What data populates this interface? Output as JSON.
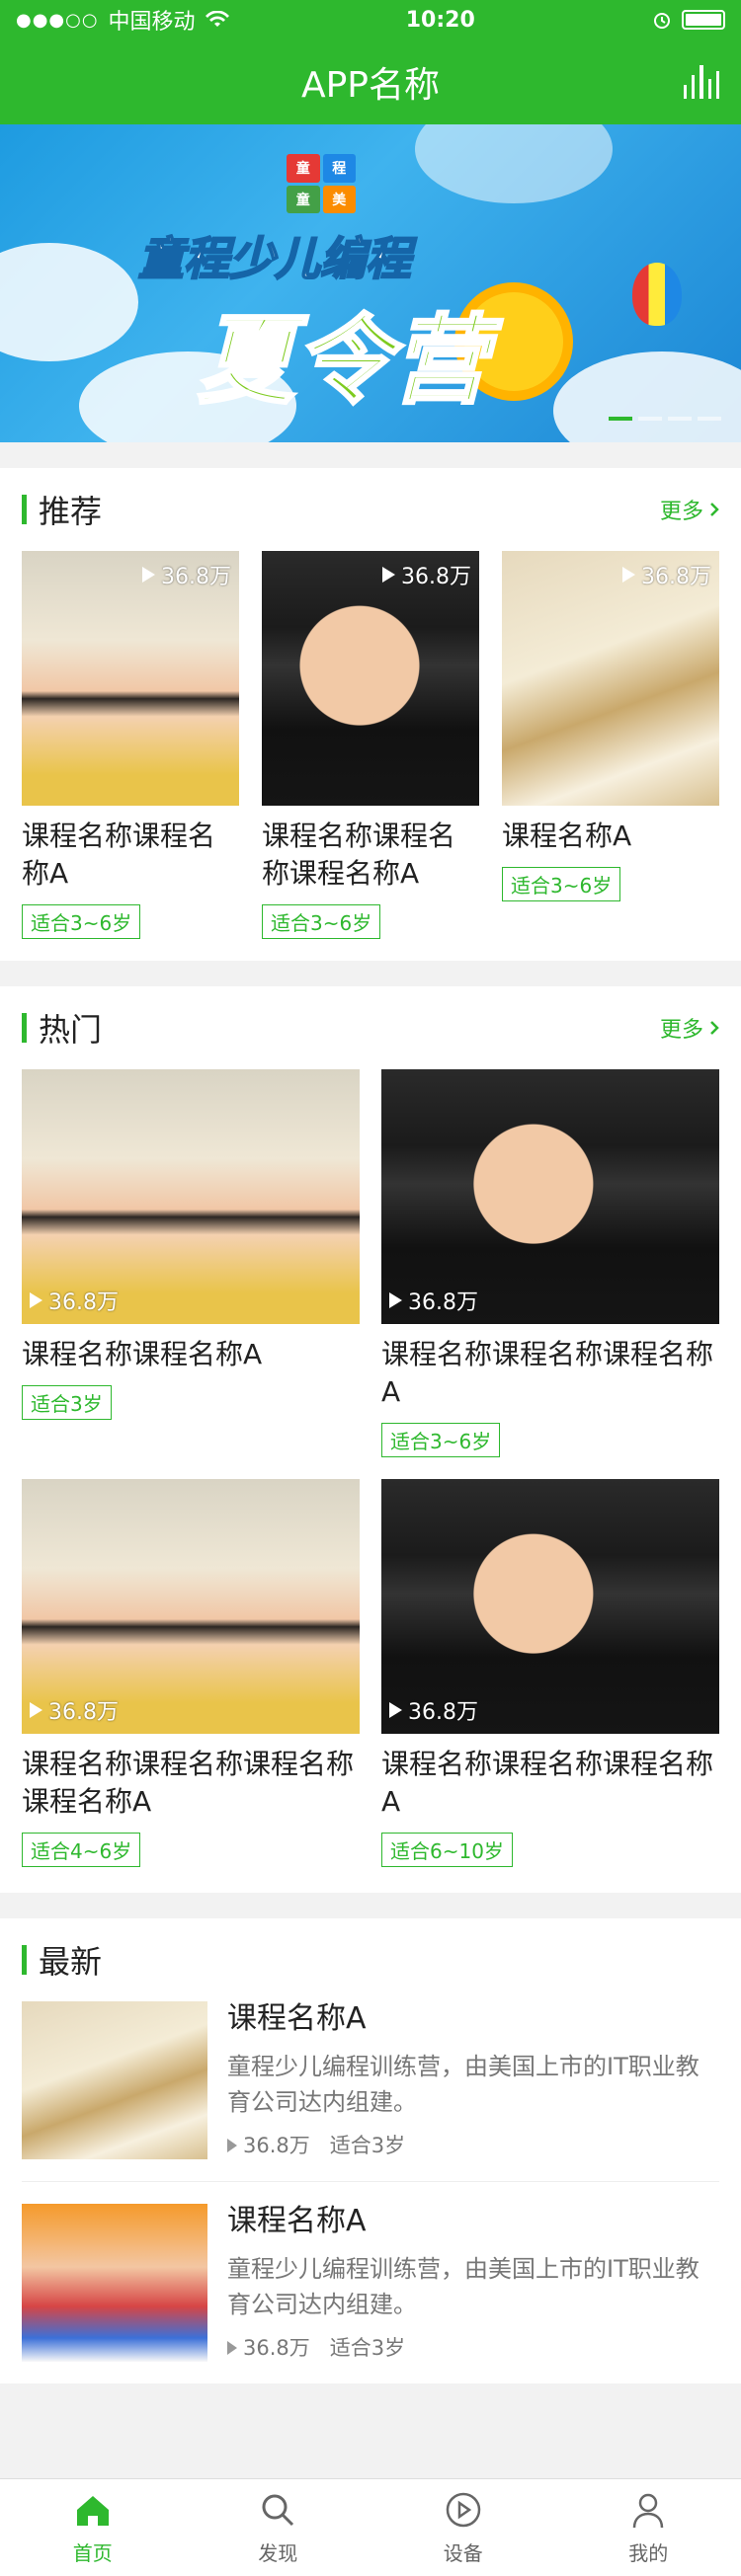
{
  "status_bar": {
    "signal": "●●●○○",
    "carrier": "中国移动",
    "time": "10:20"
  },
  "navbar": {
    "title": "APP名称"
  },
  "banner": {
    "title_line1": "童程少儿编程",
    "title_line2": "夏令营",
    "logo_chars": [
      "童",
      "程",
      "童",
      "美"
    ]
  },
  "recommend": {
    "title": "推荐",
    "more": "更多",
    "items": [
      {
        "image": "girl-raising-hand",
        "views": "36.8万",
        "title": "课程名称课程名称A",
        "tag": "适合3~6岁"
      },
      {
        "image": "boy-graduate-cap",
        "views": "36.8万",
        "title": "课程名称课程名称课程名称A",
        "tag": "适合3~6岁"
      },
      {
        "image": "open-book-glasses",
        "views": "36.8万",
        "title": "课程名称A",
        "tag": "适合3~6岁"
      }
    ]
  },
  "hot": {
    "title": "热门",
    "more": "更多",
    "items": [
      {
        "image": "girl-raising-hand",
        "views": "36.8万",
        "title": "课程名称课程名称A",
        "tag": "适合3岁"
      },
      {
        "image": "boy-graduate-cap",
        "views": "36.8万",
        "title": "课程名称课程名称课程名称A",
        "tag": "适合3~6岁"
      },
      {
        "image": "girl-raising-hand",
        "views": "36.8万",
        "title": "课程名称课程名称课程名称课程名称A",
        "tag": "适合4~6岁"
      },
      {
        "image": "boy-graduate-cap",
        "views": "36.8万",
        "title": "课程名称课程名称课程名称A",
        "tag": "适合6~10岁"
      }
    ]
  },
  "latest": {
    "title": "最新",
    "items": [
      {
        "image": "open-book-glasses",
        "title": "课程名称A",
        "desc": "童程少儿编程训练营，由美国上市的IT职业教育公司达内组建。",
        "views": "36.8万",
        "age": "适合3岁"
      },
      {
        "image": "kids-drawing",
        "title": "课程名称A",
        "desc": "童程少儿编程训练营，由美国上市的IT职业教育公司达内组建。",
        "views": "36.8万",
        "age": "适合3岁"
      }
    ]
  },
  "tabbar": {
    "tabs": [
      {
        "label": "首页",
        "icon": "home-icon",
        "active": true
      },
      {
        "label": "发现",
        "icon": "search-icon",
        "active": false
      },
      {
        "label": "设备",
        "icon": "play-circle-icon",
        "active": false
      },
      {
        "label": "我的",
        "icon": "user-icon",
        "active": false
      }
    ]
  },
  "colors": {
    "accent": "#2eb82e"
  }
}
